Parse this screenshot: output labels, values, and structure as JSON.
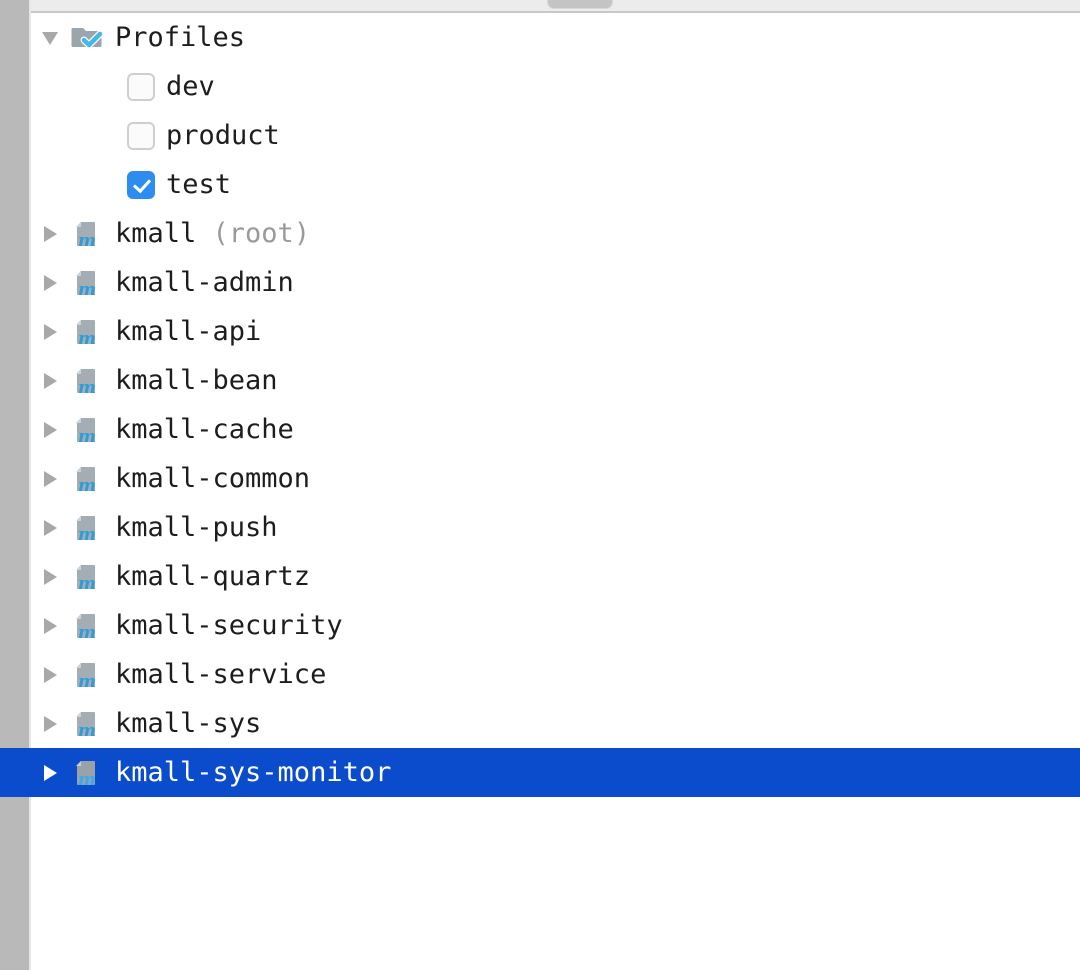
{
  "window": {
    "background_color": "#ffffff",
    "gutter_color": "#b9b9b9",
    "toolbar_color": "#ececec",
    "selection_color": "#0b4ccd",
    "accent_color": "#2d8cf0"
  },
  "tree": {
    "profiles": {
      "label": "Profiles",
      "icon": "folder-profiles-icon",
      "expanded": true,
      "items": [
        {
          "label": "dev",
          "checked": false
        },
        {
          "label": "product",
          "checked": false
        },
        {
          "label": "test",
          "checked": true
        }
      ]
    },
    "modules": [
      {
        "label": "kmall",
        "suffix": " (root)",
        "icon": "maven-module-icon",
        "expanded": false,
        "selected": false
      },
      {
        "label": "kmall-admin",
        "suffix": "",
        "icon": "maven-module-icon",
        "expanded": false,
        "selected": false
      },
      {
        "label": "kmall-api",
        "suffix": "",
        "icon": "maven-module-icon",
        "expanded": false,
        "selected": false
      },
      {
        "label": "kmall-bean",
        "suffix": "",
        "icon": "maven-module-icon",
        "expanded": false,
        "selected": false
      },
      {
        "label": "kmall-cache",
        "suffix": "",
        "icon": "maven-module-icon",
        "expanded": false,
        "selected": false
      },
      {
        "label": "kmall-common",
        "suffix": "",
        "icon": "maven-module-icon",
        "expanded": false,
        "selected": false
      },
      {
        "label": "kmall-push",
        "suffix": "",
        "icon": "maven-module-icon",
        "expanded": false,
        "selected": false
      },
      {
        "label": "kmall-quartz",
        "suffix": "",
        "icon": "maven-module-icon",
        "expanded": false,
        "selected": false
      },
      {
        "label": "kmall-security",
        "suffix": "",
        "icon": "maven-module-icon",
        "expanded": false,
        "selected": false
      },
      {
        "label": "kmall-service",
        "suffix": "",
        "icon": "maven-module-icon",
        "expanded": false,
        "selected": false
      },
      {
        "label": "kmall-sys",
        "suffix": "",
        "icon": "maven-module-icon",
        "expanded": false,
        "selected": false
      },
      {
        "label": "kmall-sys-monitor",
        "suffix": "",
        "icon": "maven-module-icon",
        "expanded": false,
        "selected": true
      }
    ]
  }
}
